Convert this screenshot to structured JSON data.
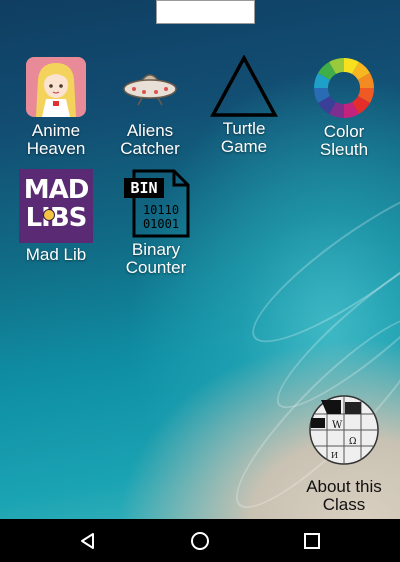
{
  "apps": [
    {
      "line1": "Anime",
      "line2": "Heaven",
      "icon": "anime-girl-icon"
    },
    {
      "line1": "Aliens",
      "line2": "Catcher",
      "icon": "ufo-icon"
    },
    {
      "line1": "Turtle",
      "line2": "Game",
      "icon": "triangle-icon"
    },
    {
      "line1": "Color",
      "line2": "Sleuth",
      "icon": "color-wheel-icon"
    },
    {
      "line1": "Mad Lib",
      "line2": "",
      "icon": "mad-libs-icon"
    },
    {
      "line1": "Binary",
      "line2": "Counter",
      "icon": "bin-file-icon"
    },
    {
      "line1": "About this",
      "line2": "Class",
      "icon": "wikipedia-globe-icon"
    }
  ],
  "madlibs_logo": {
    "line1": "MAD",
    "line2": "LIBS"
  },
  "binary_icon": {
    "tag": "BIN",
    "row1": "10110",
    "row2": "01001"
  },
  "navbar": {
    "back": "back-icon",
    "home": "home-icon",
    "recents": "recents-icon"
  },
  "colors": {
    "nav_bg": "#000000",
    "label": "#ffffff"
  }
}
